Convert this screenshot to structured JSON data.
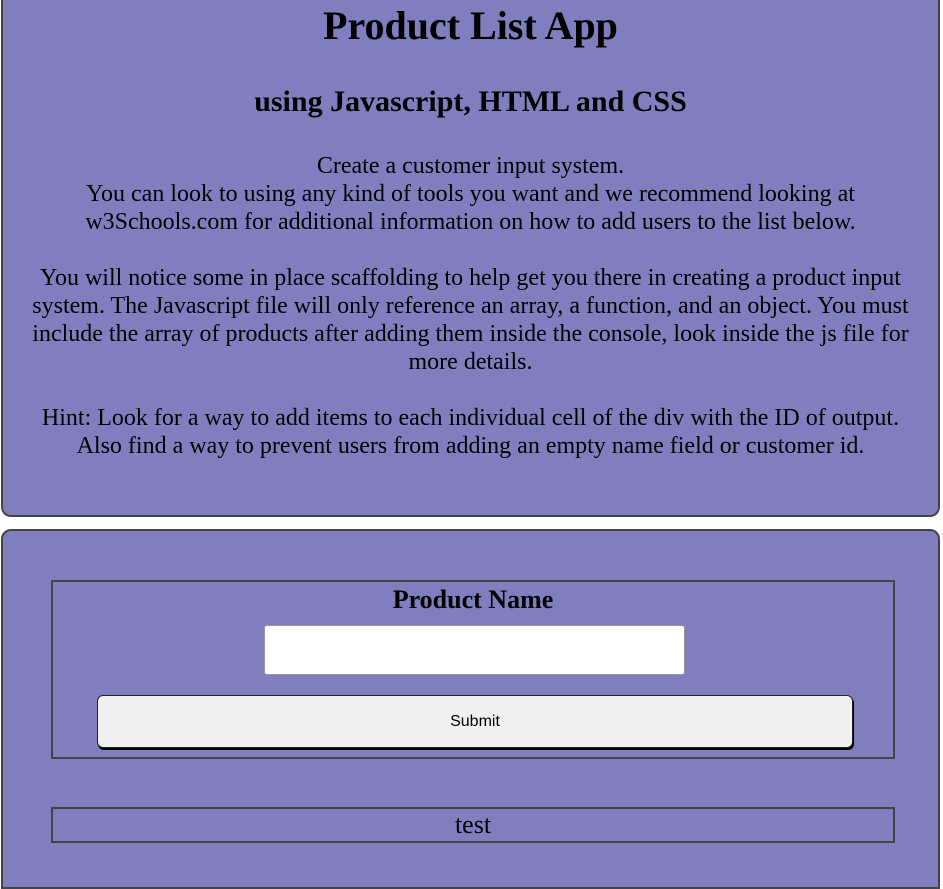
{
  "header": {
    "title": "Product List App",
    "subtitle": "using Javascript, HTML and CSS"
  },
  "intro": {
    "line1": "Create a customer input system.",
    "line2": "You can look to using any kind of tools you want and we recommend looking at w3Schools.com for additional information on how to add users to the list below.",
    "paragraph2": "You will notice some in place scaffolding to help get you there in creating a product input system. The Javascript file will only reference an array, a function, and an object. You must include the array of products after adding them inside the console, look inside the js file for more details.",
    "hint": "Hint: Look for a way to add items to each individual cell of the div with the ID of output. Also find a way to prevent users from adding an empty name field or customer id."
  },
  "form": {
    "label": "Product Name",
    "input_value": "",
    "input_placeholder": "",
    "submit_label": "Submit"
  },
  "output": {
    "items": [
      "test"
    ]
  },
  "colors": {
    "panel_background": "#7f7fbf",
    "border": "#444444",
    "button_background": "#f0f0f0"
  }
}
